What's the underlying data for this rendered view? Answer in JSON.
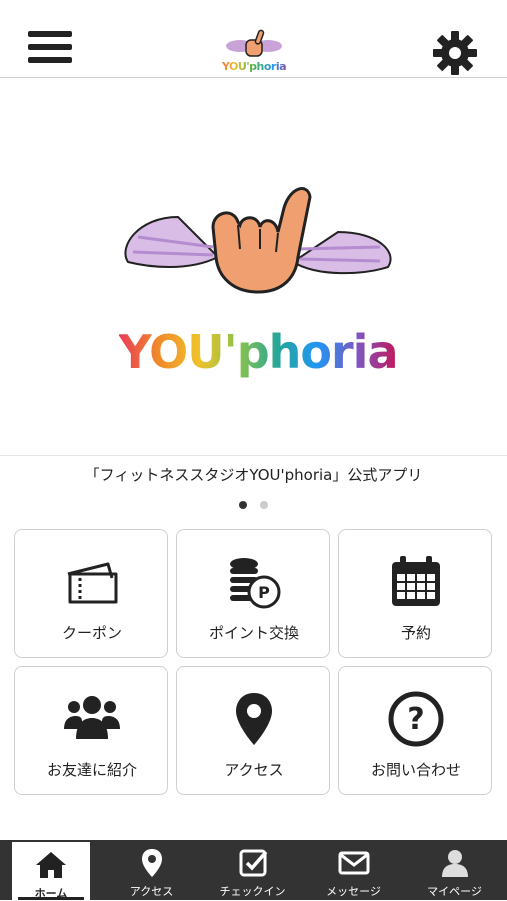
{
  "header": {
    "logo_text": "YOU'phoria"
  },
  "hero": {
    "brand_text": "YOU'phoria"
  },
  "caption": "「フィットネススタジオYOU'phoria」公式アプリ",
  "carousel": {
    "total": 2,
    "active": 1
  },
  "tiles": [
    {
      "label": "クーポン",
      "icon": "ticket-icon"
    },
    {
      "label": "ポイント交換",
      "icon": "coins-icon"
    },
    {
      "label": "予約",
      "icon": "calendar-icon"
    },
    {
      "label": "お友達に紹介",
      "icon": "users-icon"
    },
    {
      "label": "アクセス",
      "icon": "map-pin-icon"
    },
    {
      "label": "お問い合わせ",
      "icon": "question-icon"
    }
  ],
  "tabbar": [
    {
      "label": "ホーム",
      "icon": "home-icon",
      "active": true
    },
    {
      "label": "アクセス",
      "icon": "map-pin-icon",
      "active": false
    },
    {
      "label": "チェックイン",
      "icon": "checkin-icon",
      "active": false
    },
    {
      "label": "メッセージ",
      "icon": "mail-icon",
      "active": false
    },
    {
      "label": "マイページ",
      "icon": "user-icon",
      "active": false
    }
  ],
  "colors": {
    "tabbar_bg": "#333333",
    "icon_color": "#222222",
    "hand": "#f0a070",
    "wings": "#c9a3d8"
  }
}
